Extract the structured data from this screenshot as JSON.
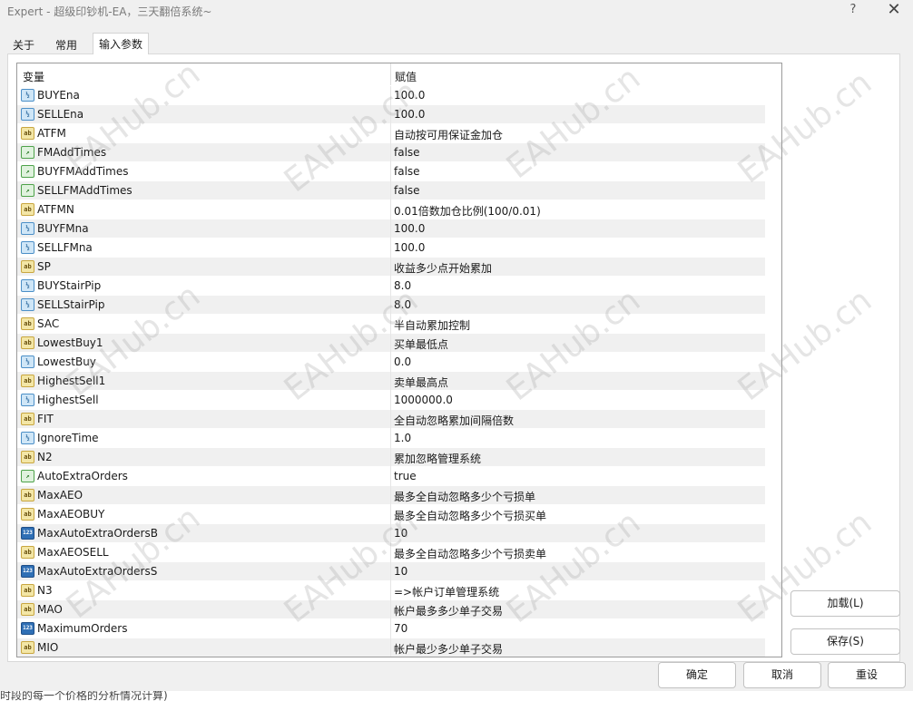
{
  "window": {
    "title": "Expert - 超级印钞机-EA，三天翻倍系统~",
    "help_glyph": "?",
    "close_glyph": "✕"
  },
  "tabs": [
    {
      "label": "关于",
      "active": false
    },
    {
      "label": "常用",
      "active": false
    },
    {
      "label": "输入参数",
      "active": true
    }
  ],
  "grid": {
    "col_variable": "变量",
    "col_value": "赋值",
    "rows": [
      {
        "type": "v2",
        "name": "BUYEna",
        "value": "100.0"
      },
      {
        "type": "v2",
        "name": "SELLEna",
        "value": "100.0"
      },
      {
        "type": "ab",
        "name": "ATFM",
        "value": "自动按可用保证金加仓"
      },
      {
        "type": "bool",
        "name": "FMAddTimes",
        "value": "false"
      },
      {
        "type": "bool",
        "name": "BUYFMAddTimes",
        "value": "false"
      },
      {
        "type": "bool",
        "name": "SELLFMAddTimes",
        "value": "false"
      },
      {
        "type": "ab",
        "name": "ATFMN",
        "value": "0.01倍数加仓比例(100/0.01)"
      },
      {
        "type": "v2",
        "name": "BUYFMna",
        "value": "100.0"
      },
      {
        "type": "v2",
        "name": "SELLFMna",
        "value": "100.0"
      },
      {
        "type": "ab",
        "name": "SP",
        "value": "收益多少点开始累加"
      },
      {
        "type": "v2",
        "name": "BUYStairPip",
        "value": "8.0"
      },
      {
        "type": "v2",
        "name": "SELLStairPip",
        "value": "8.0"
      },
      {
        "type": "ab",
        "name": "SAC",
        "value": "半自动累加控制"
      },
      {
        "type": "ab",
        "name": "LowestBuy1",
        "value": "买单最低点"
      },
      {
        "type": "v2",
        "name": "LowestBuy",
        "value": "0.0"
      },
      {
        "type": "ab",
        "name": "HighestSell1",
        "value": "卖单最高点"
      },
      {
        "type": "v2",
        "name": "HighestSell",
        "value": "1000000.0"
      },
      {
        "type": "ab",
        "name": "FIT",
        "value": "全自动忽略累加间隔倍数"
      },
      {
        "type": "v2",
        "name": "IgnoreTime",
        "value": "1.0"
      },
      {
        "type": "ab",
        "name": "N2",
        "value": "累加忽略管理系统"
      },
      {
        "type": "bool",
        "name": "AutoExtraOrders",
        "value": "true"
      },
      {
        "type": "ab",
        "name": "MaxAEO",
        "value": "最多全自动忽略多少个亏损单"
      },
      {
        "type": "ab",
        "name": "MaxAEOBUY",
        "value": "最多全自动忽略多少个亏损买单"
      },
      {
        "type": "i123",
        "name": "MaxAutoExtraOrdersB",
        "value": "10"
      },
      {
        "type": "ab",
        "name": "MaxAEOSELL",
        "value": "最多全自动忽略多少个亏损卖单"
      },
      {
        "type": "i123",
        "name": "MaxAutoExtraOrdersS",
        "value": "10"
      },
      {
        "type": "ab",
        "name": "N3",
        "value": "=>帐户订单管理系统"
      },
      {
        "type": "ab",
        "name": "MAO",
        "value": "帐户最多多少单子交易"
      },
      {
        "type": "i123",
        "name": "MaximumOrders",
        "value": "70"
      },
      {
        "type": "ab",
        "name": "MIO",
        "value": "帐户最少多少单子交易"
      }
    ]
  },
  "icons": {
    "ab": "ab",
    "v2": "½",
    "bool": "↗",
    "i123": "123"
  },
  "watermark_text": "EAHub.cn",
  "buttons": {
    "load": "加载(L)",
    "save": "保存(S)",
    "ok": "确定",
    "cancel": "取消",
    "reset": "重设"
  },
  "footer_text": "时段的每一个价格的分析情况计算)"
}
